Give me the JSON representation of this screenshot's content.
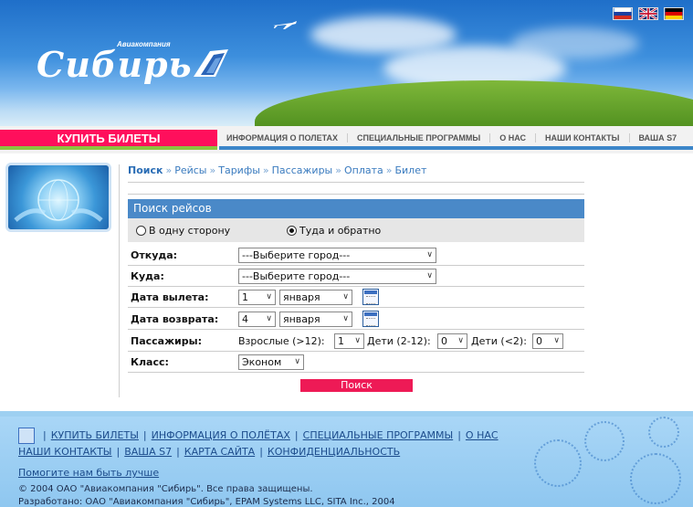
{
  "header": {
    "logo_text": "Сибирь",
    "logo_subtext": "Авиакомпания",
    "flags": [
      {
        "name": "ru-flag-icon",
        "colors": [
          "#ffffff",
          "#1c3fa0",
          "#d52b1e"
        ]
      },
      {
        "name": "uk-flag-icon",
        "colors": [
          "#012169",
          "#ffffff",
          "#c8102e"
        ]
      },
      {
        "name": "de-flag-icon",
        "colors": [
          "#000000",
          "#dd0000",
          "#ffce00"
        ]
      }
    ]
  },
  "nav": {
    "buy": "КУПИТЬ БИЛЕТЫ",
    "links": [
      "ИНФОРМАЦИЯ О ПОЛЕТАХ",
      "СПЕЦИАЛЬНЫЕ ПРОГРАММЫ",
      "О НАС",
      "НАШИ КОНТАКТЫ",
      "ВАША S7"
    ]
  },
  "breadcrumbs": [
    "Поиск",
    "Рейсы",
    "Тарифы",
    "Пассажиры",
    "Оплата",
    "Билет"
  ],
  "form": {
    "title": "Поиск рейсов",
    "trip_one_way": "В одну сторону",
    "trip_round": "Туда и обратно",
    "trip_selected": "round",
    "from_label": "Откуда:",
    "from_value": "---Выберите город---",
    "to_label": "Куда:",
    "to_value": "---Выберите город---",
    "depart_label": "Дата вылета:",
    "depart_day": "1",
    "depart_month": "января",
    "return_label": "Дата возврата:",
    "return_day": "4",
    "return_month": "января",
    "passengers_label": "Пассажиры:",
    "adults_label": "Взрослые (>12):",
    "adults_value": "1",
    "children_label": "Дети (2-12):",
    "children_value": "0",
    "infants_label": "Дети (<2):",
    "infants_value": "0",
    "class_label": "Класс:",
    "class_value": "Эконом",
    "search_button": "Поиск"
  },
  "footer": {
    "row1": [
      "КУПИТЬ БИЛЕТЫ",
      "ИНФОРМАЦИЯ О ПОЛЁТАХ",
      "СПЕЦИАЛЬНЫЕ ПРОГРАММЫ",
      "О НАС"
    ],
    "row2": [
      "НАШИ КОНТАКТЫ",
      "ВАША S7",
      "КАРТА САЙТА",
      "КОНФИДЕНЦИАЛЬНОСТЬ"
    ],
    "help": "Помогите нам быть лучше",
    "copyright": "© 2004 ОАО \"Авиакомпания \"Сибирь\". Все права защищены.",
    "developed": "Разработано: ОАО \"Авиакомпания \"Сибирь\", EPAM Systems LLC, SITA Inc., 2004"
  },
  "colors": {
    "accent": "#ff0f5c",
    "nav_blue": "#3c86c9",
    "panel_blue": "#4a89c8",
    "link": "#2a6db5",
    "footer_bg": "#a9d6f6"
  }
}
